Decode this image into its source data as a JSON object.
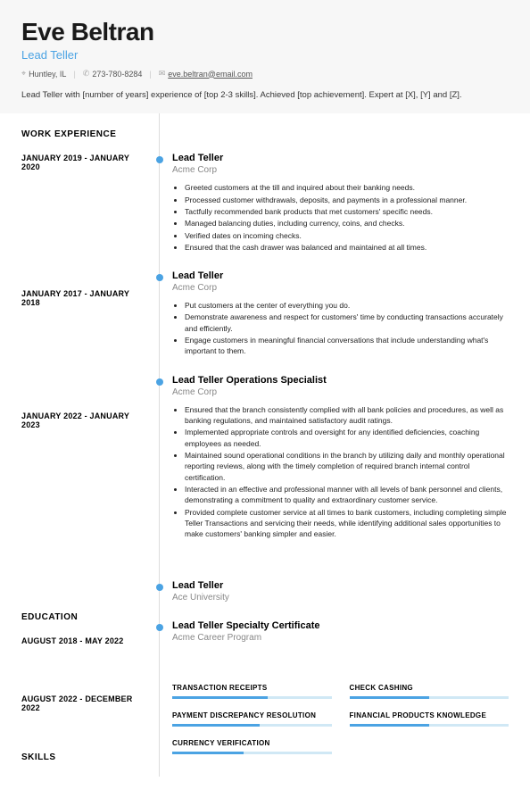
{
  "header": {
    "name": "Eve Beltran",
    "title": "Lead Teller",
    "location": "Huntley, IL",
    "phone": "273-780-8284",
    "email": "eve.beltran@email.com",
    "summary": "Lead Teller with [number of years] experience of [top 2-3 skills]. Achieved [top achievement]. Expert at [X], [Y] and [Z]."
  },
  "sections": {
    "work_experience_label": "WORK EXPERIENCE",
    "education_label": "EDUCATION",
    "skills_label": "SKILLS"
  },
  "work": [
    {
      "dates": "JANUARY 2019 - JANUARY 2020",
      "title": "Lead Teller",
      "company": "Acme Corp",
      "bullets": [
        "Greeted customers at the till and inquired about their banking needs.",
        "Processed customer withdrawals, deposits, and payments in a professional manner.",
        "Tactfully recommended bank products that met customers' specific needs.",
        "Managed balancing duties, including currency, coins, and checks.",
        "Verified dates on incoming checks.",
        "Ensured that the cash drawer was balanced and maintained at all times."
      ]
    },
    {
      "dates": "JANUARY 2017 - JANUARY 2018",
      "title": "Lead Teller",
      "company": "Acme Corp",
      "bullets": [
        "Put customers at the center of everything you do.",
        "Demonstrate awareness and respect for customers' time by conducting transactions accurately and efficiently.",
        "Engage customers in meaningful financial conversations that include understanding what's important to them."
      ]
    },
    {
      "dates": "JANUARY 2022 - JANUARY 2023",
      "title": "Lead Teller Operations Specialist",
      "company": "Acme Corp",
      "bullets": [
        "Ensured that the branch consistently complied with all bank policies and procedures, as well as banking regulations, and maintained satisfactory audit ratings.",
        "Implemented appropriate controls and oversight for any identified deficiencies, coaching employees as needed.",
        "Maintained sound operational conditions in the branch by utilizing daily and monthly operational reporting reviews, along with the timely completion of required branch internal control certification.",
        "Interacted in an effective and professional manner with all levels of bank personnel and clients, demonstrating a commitment to quality and extraordinary customer service.",
        "Provided complete customer service at all times to bank customers, including completing simple Teller Transactions and servicing their needs, while identifying additional sales opportunities to make customers' banking simpler and easier."
      ]
    }
  ],
  "education": [
    {
      "dates": "AUGUST 2018 - MAY 2022",
      "title": "Lead Teller",
      "company": "Ace University"
    },
    {
      "dates": "AUGUST 2022 - DECEMBER 2022",
      "title": "Lead Teller Specialty Certificate",
      "company": "Acme Career Program"
    }
  ],
  "skills": [
    {
      "name": "TRANSACTION RECEIPTS",
      "level": 60
    },
    {
      "name": "CHECK CASHING",
      "level": 50
    },
    {
      "name": "PAYMENT DISCREPANCY RESOLUTION",
      "level": 55
    },
    {
      "name": "FINANCIAL PRODUCTS KNOWLEDGE",
      "level": 50
    },
    {
      "name": "CURRENCY VERIFICATION",
      "level": 45
    }
  ]
}
